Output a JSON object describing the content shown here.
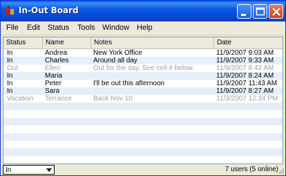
{
  "window": {
    "title": "In-Out Board"
  },
  "menu": [
    "File",
    "Edit",
    "Status",
    "Tools",
    "Window",
    "Help"
  ],
  "columns": [
    "Status",
    "Name",
    "Notes",
    "Date"
  ],
  "rows": [
    {
      "status": "In",
      "name": "Andrea",
      "notes": "New York Office",
      "date": "11/9/2007 9:03 AM",
      "dim": false
    },
    {
      "status": "In",
      "name": "Charles",
      "notes": "Around all day",
      "date": "11/9/2007 9:33 AM",
      "dim": false
    },
    {
      "status": "Out",
      "name": "Ellen",
      "notes": "Out for the day.  See cell # below.",
      "date": "11/9/2007 8:42 AM",
      "dim": true
    },
    {
      "status": "In",
      "name": "Maria",
      "notes": "",
      "date": "11/9/2007 8:24 AM",
      "dim": false
    },
    {
      "status": "In",
      "name": "Peter",
      "notes": "I'll be out this afternoon",
      "date": "11/9/2007 11:43 AM",
      "dim": false
    },
    {
      "status": "In",
      "name": "Sara",
      "notes": "",
      "date": "11/9/2007 8:27 AM",
      "dim": false
    },
    {
      "status": "Vacation",
      "name": "Terrance",
      "notes": "Back Nov 10",
      "date": "11/3/2007 12:34 PM",
      "dim": true
    }
  ],
  "empty_rows": 8,
  "status_select": {
    "value": "In"
  },
  "users_summary": "7 users (5 online)",
  "colors": {
    "title_bar": "#0a5ae0",
    "row_alt": "#e6eefa",
    "dim_text": "#a0a0a0",
    "close_button": "#c84520"
  },
  "icons": [
    "app-icon",
    "minimize-icon",
    "maximize-icon",
    "close-icon",
    "dropdown-arrow-icon",
    "resize-grip-icon"
  ]
}
